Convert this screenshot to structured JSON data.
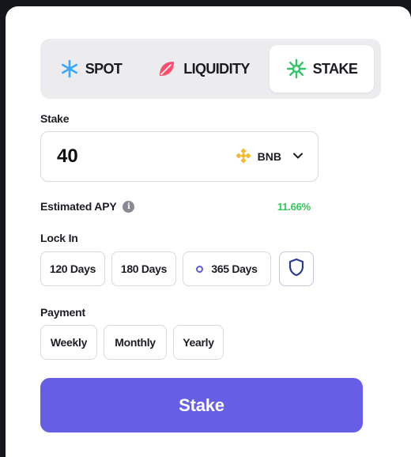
{
  "tabs": [
    {
      "label": "SPOT",
      "icon": "snowflake-icon",
      "color": "#3aa8ff"
    },
    {
      "label": "LIQUIDITY",
      "icon": "leaf-icon",
      "color": "#ff4d6d"
    },
    {
      "label": "STAKE",
      "icon": "sparkle-icon",
      "color": "#2fc46a",
      "active": true
    }
  ],
  "stake": {
    "label": "Stake",
    "value": "40",
    "token": "BNB"
  },
  "apy": {
    "label": "Estimated APY",
    "info_icon": "i",
    "value": "11.66%"
  },
  "lock_in": {
    "label": "Lock In",
    "options": [
      "120 Days",
      "180 Days",
      "365 Days"
    ],
    "selected": "365 Days"
  },
  "payment": {
    "label": "Payment",
    "options": [
      "Weekly",
      "Monthly",
      "Yearly"
    ]
  },
  "submit": {
    "label": "Stake"
  },
  "colors": {
    "accent": "#675ee6",
    "apy_green": "#34c759",
    "bnb_yellow": "#f3ba2f"
  }
}
